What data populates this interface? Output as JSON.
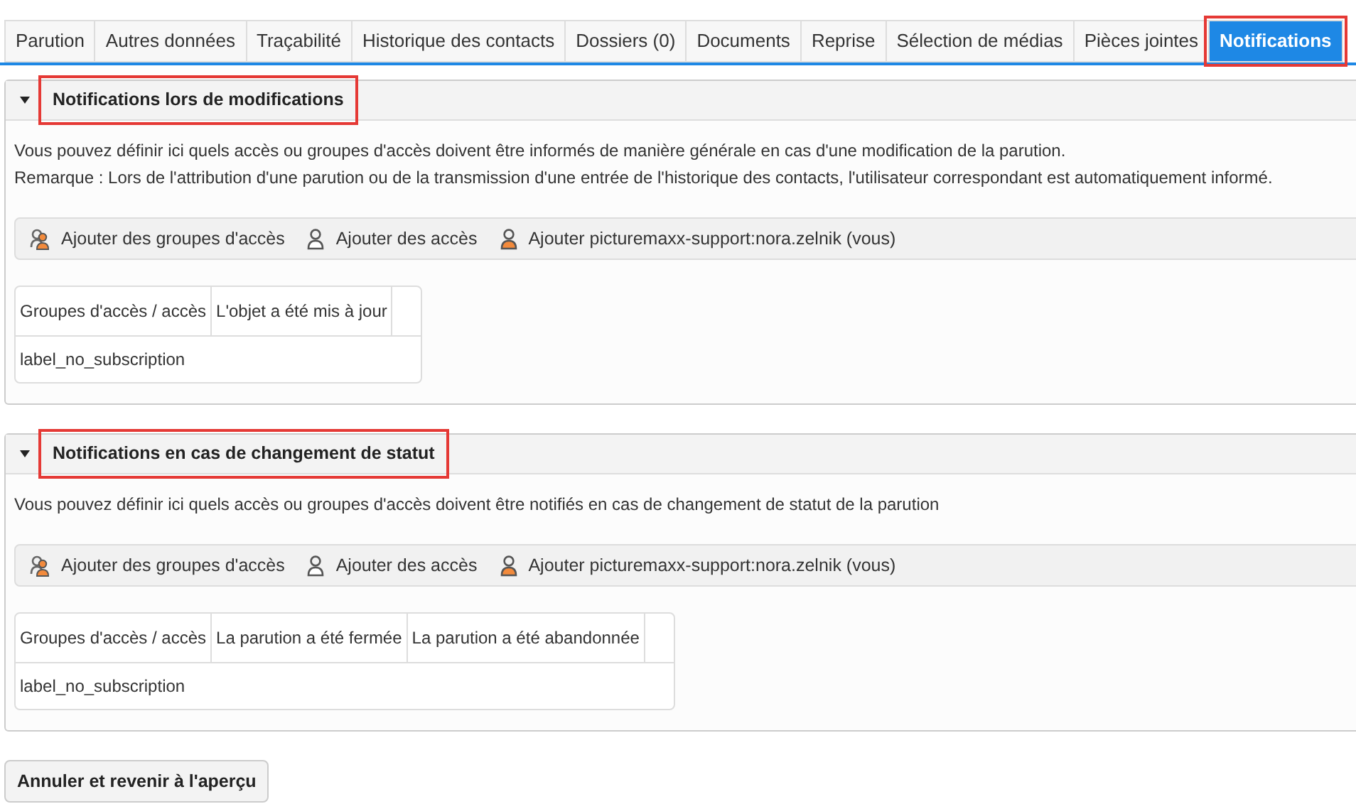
{
  "tabs": [
    {
      "label": "Parution",
      "selected": false,
      "highlighted": false
    },
    {
      "label": "Autres données",
      "selected": false,
      "highlighted": false
    },
    {
      "label": "Traçabilité",
      "selected": false,
      "highlighted": false
    },
    {
      "label": "Historique des contacts",
      "selected": false,
      "highlighted": false
    },
    {
      "label": "Dossiers (0)",
      "selected": false,
      "highlighted": false
    },
    {
      "label": "Documents",
      "selected": false,
      "highlighted": false
    },
    {
      "label": "Reprise",
      "selected": false,
      "highlighted": false
    },
    {
      "label": "Sélection de médias",
      "selected": false,
      "highlighted": false
    },
    {
      "label": "Pièces jointes",
      "selected": false,
      "highlighted": false
    },
    {
      "label": "Notifications",
      "selected": true,
      "highlighted": true
    }
  ],
  "sections": [
    {
      "title": "Notifications lors de modifications",
      "expanded": true,
      "highlighted": true,
      "description": [
        "Vous pouvez définir ici quels accès ou groupes d'accès doivent être informés de manière générale en cas d'une modification de la parution.",
        "Remarque : Lors de l'attribution d'une parution ou de la transmission d'une entrée de l'historique des contacts, l'utilisateur correspondant est automatiquement informé."
      ],
      "actions": [
        {
          "kind": "group",
          "label": "Ajouter des groupes d'accès"
        },
        {
          "kind": "user",
          "label": "Ajouter des accès"
        },
        {
          "kind": "self",
          "label": "Ajouter picturemaxx-support:nora.zelnik (vous)"
        }
      ],
      "table": {
        "columns": [
          "Groupes d'accès / accès",
          "L'objet a été mis à jour"
        ],
        "rows": [
          "label_no_subscription"
        ]
      }
    },
    {
      "title": "Notifications en cas de changement de statut",
      "expanded": true,
      "highlighted": true,
      "description": [
        "Vous pouvez définir ici quels accès ou groupes d'accès doivent être notifiés en cas de changement de statut de la parution"
      ],
      "actions": [
        {
          "kind": "group",
          "label": "Ajouter des groupes d'accès"
        },
        {
          "kind": "user",
          "label": "Ajouter des accès"
        },
        {
          "kind": "self",
          "label": "Ajouter picturemaxx-support:nora.zelnik (vous)"
        }
      ],
      "table": {
        "columns": [
          "Groupes d'accès / accès",
          "La parution a été fermée",
          "La parution a été abandonnée"
        ],
        "rows": [
          "label_no_subscription"
        ]
      }
    }
  ],
  "cancel_button": "Annuler et revenir à l'aperçu"
}
